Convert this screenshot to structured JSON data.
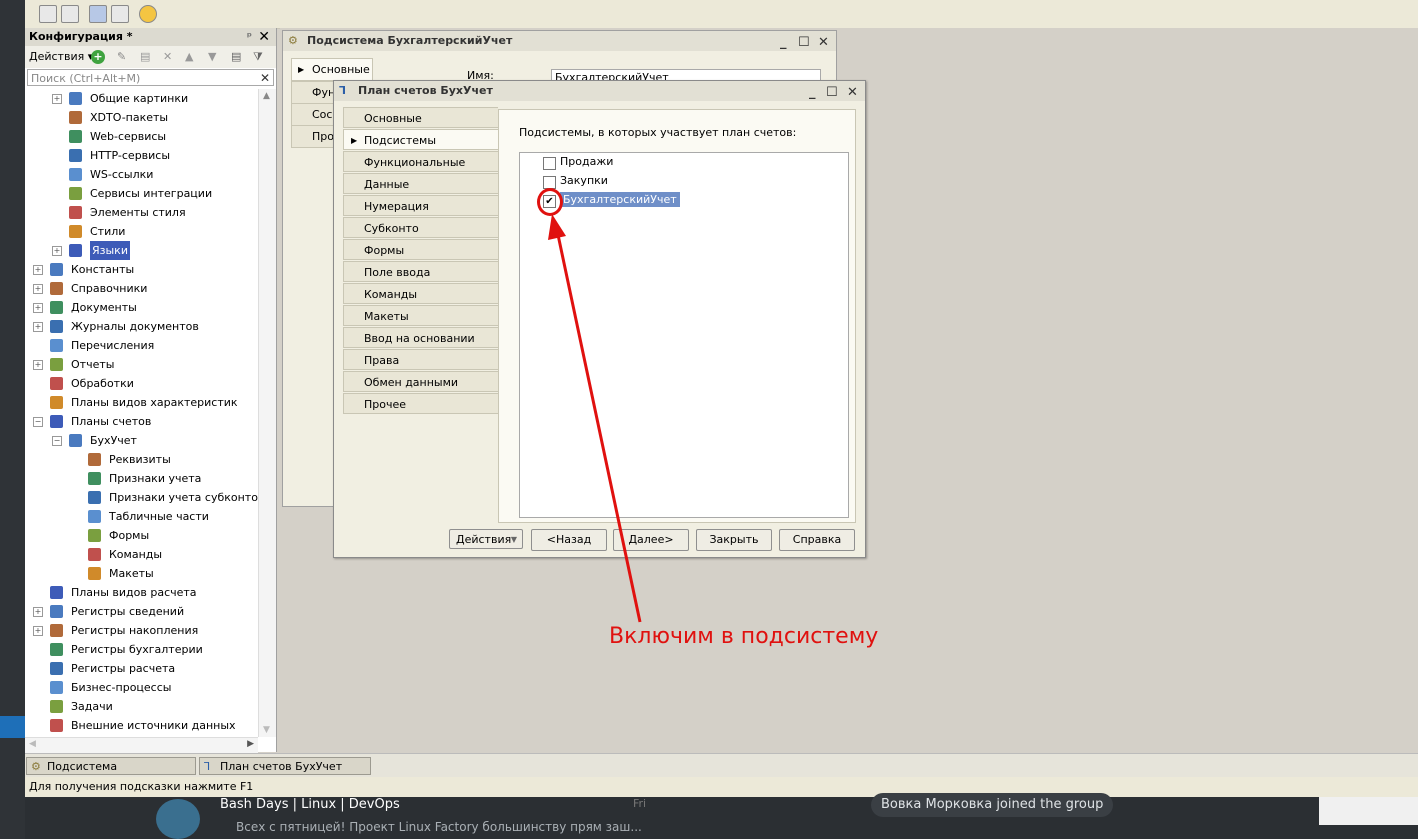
{
  "config": {
    "title": "Конфигурация *",
    "actions_label": "Действия",
    "search_placeholder": "Поиск (Ctrl+Alt+M)",
    "tree": [
      {
        "label": "Общие картинки",
        "level": 2,
        "expand": "+"
      },
      {
        "label": "XDTO-пакеты",
        "level": 2
      },
      {
        "label": "Web-сервисы",
        "level": 2
      },
      {
        "label": "HTTP-сервисы",
        "level": 2
      },
      {
        "label": "WS-ссылки",
        "level": 2
      },
      {
        "label": "Сервисы интеграции",
        "level": 2
      },
      {
        "label": "Элементы стиля",
        "level": 2
      },
      {
        "label": "Стили",
        "level": 2
      },
      {
        "label": "Языки",
        "level": 2,
        "expand": "+",
        "selected": true
      },
      {
        "label": "Константы",
        "level": 1,
        "expand": "+"
      },
      {
        "label": "Справочники",
        "level": 1,
        "expand": "+"
      },
      {
        "label": "Документы",
        "level": 1,
        "expand": "+"
      },
      {
        "label": "Журналы документов",
        "level": 1,
        "expand": "+"
      },
      {
        "label": "Перечисления",
        "level": 1
      },
      {
        "label": "Отчеты",
        "level": 1,
        "expand": "+"
      },
      {
        "label": "Обработки",
        "level": 1
      },
      {
        "label": "Планы видов характеристик",
        "level": 1
      },
      {
        "label": "Планы счетов",
        "level": 1,
        "expand": "-"
      },
      {
        "label": "БухУчет",
        "level": 2,
        "expand": "-"
      },
      {
        "label": "Реквизиты",
        "level": 3
      },
      {
        "label": "Признаки учета",
        "level": 3
      },
      {
        "label": "Признаки учета субконто",
        "level": 3
      },
      {
        "label": "Табличные части",
        "level": 3
      },
      {
        "label": "Формы",
        "level": 3
      },
      {
        "label": "Команды",
        "level": 3
      },
      {
        "label": "Макеты",
        "level": 3
      },
      {
        "label": "Планы видов расчета",
        "level": 1
      },
      {
        "label": "Регистры сведений",
        "level": 1,
        "expand": "+"
      },
      {
        "label": "Регистры накопления",
        "level": 1,
        "expand": "+"
      },
      {
        "label": "Регистры бухгалтерии",
        "level": 1
      },
      {
        "label": "Регистры расчета",
        "level": 1
      },
      {
        "label": "Бизнес-процессы",
        "level": 1
      },
      {
        "label": "Задачи",
        "level": 1
      },
      {
        "label": "Внешние источники данных",
        "level": 1
      }
    ]
  },
  "subsystem_window": {
    "title": "Подсистема БухгалтерскийУчет",
    "tabs": [
      "Основные",
      "Фун",
      "Сос",
      "Про"
    ],
    "name_label": "Имя:",
    "name_value": "БухгалтерскийУчет"
  },
  "plan_window": {
    "title": "План счетов БухУчет",
    "tabs": [
      "Основные",
      "Подсистемы",
      "Функциональные опции",
      "Данные",
      "Нумерация",
      "Субконто",
      "Формы",
      "Поле ввода",
      "Команды",
      "Макеты",
      "Ввод на основании",
      "Права",
      "Обмен данными",
      "Прочее"
    ],
    "active_tab_index": 1,
    "subsystems_label": "Подсистемы, в которых участвует план счетов:",
    "subsystems": [
      {
        "label": "Продажи",
        "checked": false
      },
      {
        "label": "Закупки",
        "checked": false
      },
      {
        "label": "БухгалтерскийУчет",
        "checked": true
      }
    ],
    "buttons": {
      "actions": "Действия",
      "back": "<Назад",
      "next": "Далее>",
      "close": "Закрыть",
      "help": "Справка"
    }
  },
  "taskbar": {
    "items": [
      "Подсистема Бухгалтерски...",
      "План счетов БухУчет"
    ]
  },
  "status_text": "Для получения подсказки нажмите F1",
  "annotation": {
    "text": "Включим в подсистему",
    "color": "#e0110f"
  },
  "chat": {
    "channel": "Bash Days | Linux | DevOps",
    "day": "Fri",
    "preview": "Всех с пятницей!  Проект Linux Factory большинству прям заш...",
    "notice": "Вовка Морковка joined the group"
  }
}
